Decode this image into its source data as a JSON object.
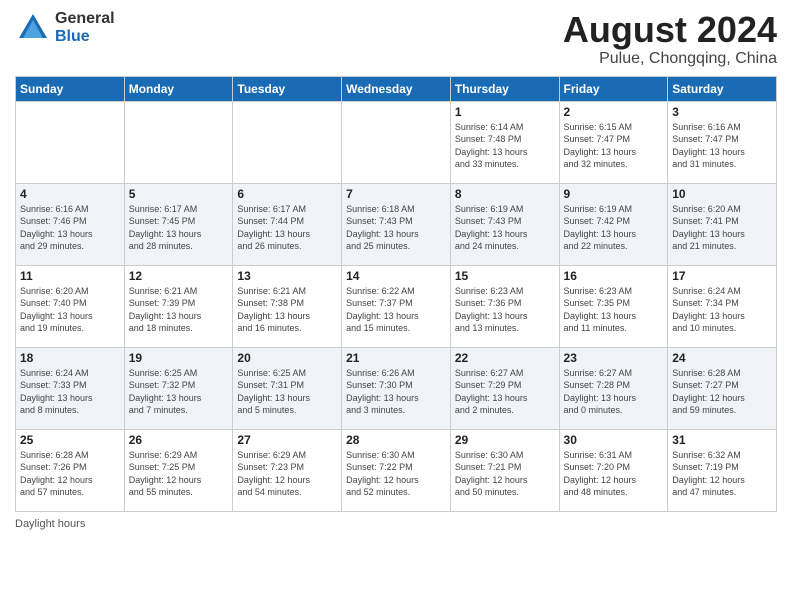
{
  "header": {
    "logo_general": "General",
    "logo_blue": "Blue",
    "month_year": "August 2024",
    "location": "Pulue, Chongqing, China"
  },
  "weekdays": [
    "Sunday",
    "Monday",
    "Tuesday",
    "Wednesday",
    "Thursday",
    "Friday",
    "Saturday"
  ],
  "footer": {
    "daylight_label": "Daylight hours"
  },
  "weeks": [
    [
      {
        "day": "",
        "info": ""
      },
      {
        "day": "",
        "info": ""
      },
      {
        "day": "",
        "info": ""
      },
      {
        "day": "",
        "info": ""
      },
      {
        "day": "1",
        "info": "Sunrise: 6:14 AM\nSunset: 7:48 PM\nDaylight: 13 hours\nand 33 minutes."
      },
      {
        "day": "2",
        "info": "Sunrise: 6:15 AM\nSunset: 7:47 PM\nDaylight: 13 hours\nand 32 minutes."
      },
      {
        "day": "3",
        "info": "Sunrise: 6:16 AM\nSunset: 7:47 PM\nDaylight: 13 hours\nand 31 minutes."
      }
    ],
    [
      {
        "day": "4",
        "info": "Sunrise: 6:16 AM\nSunset: 7:46 PM\nDaylight: 13 hours\nand 29 minutes."
      },
      {
        "day": "5",
        "info": "Sunrise: 6:17 AM\nSunset: 7:45 PM\nDaylight: 13 hours\nand 28 minutes."
      },
      {
        "day": "6",
        "info": "Sunrise: 6:17 AM\nSunset: 7:44 PM\nDaylight: 13 hours\nand 26 minutes."
      },
      {
        "day": "7",
        "info": "Sunrise: 6:18 AM\nSunset: 7:43 PM\nDaylight: 13 hours\nand 25 minutes."
      },
      {
        "day": "8",
        "info": "Sunrise: 6:19 AM\nSunset: 7:43 PM\nDaylight: 13 hours\nand 24 minutes."
      },
      {
        "day": "9",
        "info": "Sunrise: 6:19 AM\nSunset: 7:42 PM\nDaylight: 13 hours\nand 22 minutes."
      },
      {
        "day": "10",
        "info": "Sunrise: 6:20 AM\nSunset: 7:41 PM\nDaylight: 13 hours\nand 21 minutes."
      }
    ],
    [
      {
        "day": "11",
        "info": "Sunrise: 6:20 AM\nSunset: 7:40 PM\nDaylight: 13 hours\nand 19 minutes."
      },
      {
        "day": "12",
        "info": "Sunrise: 6:21 AM\nSunset: 7:39 PM\nDaylight: 13 hours\nand 18 minutes."
      },
      {
        "day": "13",
        "info": "Sunrise: 6:21 AM\nSunset: 7:38 PM\nDaylight: 13 hours\nand 16 minutes."
      },
      {
        "day": "14",
        "info": "Sunrise: 6:22 AM\nSunset: 7:37 PM\nDaylight: 13 hours\nand 15 minutes."
      },
      {
        "day": "15",
        "info": "Sunrise: 6:23 AM\nSunset: 7:36 PM\nDaylight: 13 hours\nand 13 minutes."
      },
      {
        "day": "16",
        "info": "Sunrise: 6:23 AM\nSunset: 7:35 PM\nDaylight: 13 hours\nand 11 minutes."
      },
      {
        "day": "17",
        "info": "Sunrise: 6:24 AM\nSunset: 7:34 PM\nDaylight: 13 hours\nand 10 minutes."
      }
    ],
    [
      {
        "day": "18",
        "info": "Sunrise: 6:24 AM\nSunset: 7:33 PM\nDaylight: 13 hours\nand 8 minutes."
      },
      {
        "day": "19",
        "info": "Sunrise: 6:25 AM\nSunset: 7:32 PM\nDaylight: 13 hours\nand 7 minutes."
      },
      {
        "day": "20",
        "info": "Sunrise: 6:25 AM\nSunset: 7:31 PM\nDaylight: 13 hours\nand 5 minutes."
      },
      {
        "day": "21",
        "info": "Sunrise: 6:26 AM\nSunset: 7:30 PM\nDaylight: 13 hours\nand 3 minutes."
      },
      {
        "day": "22",
        "info": "Sunrise: 6:27 AM\nSunset: 7:29 PM\nDaylight: 13 hours\nand 2 minutes."
      },
      {
        "day": "23",
        "info": "Sunrise: 6:27 AM\nSunset: 7:28 PM\nDaylight: 13 hours\nand 0 minutes."
      },
      {
        "day": "24",
        "info": "Sunrise: 6:28 AM\nSunset: 7:27 PM\nDaylight: 12 hours\nand 59 minutes."
      }
    ],
    [
      {
        "day": "25",
        "info": "Sunrise: 6:28 AM\nSunset: 7:26 PM\nDaylight: 12 hours\nand 57 minutes."
      },
      {
        "day": "26",
        "info": "Sunrise: 6:29 AM\nSunset: 7:25 PM\nDaylight: 12 hours\nand 55 minutes."
      },
      {
        "day": "27",
        "info": "Sunrise: 6:29 AM\nSunset: 7:23 PM\nDaylight: 12 hours\nand 54 minutes."
      },
      {
        "day": "28",
        "info": "Sunrise: 6:30 AM\nSunset: 7:22 PM\nDaylight: 12 hours\nand 52 minutes."
      },
      {
        "day": "29",
        "info": "Sunrise: 6:30 AM\nSunset: 7:21 PM\nDaylight: 12 hours\nand 50 minutes."
      },
      {
        "day": "30",
        "info": "Sunrise: 6:31 AM\nSunset: 7:20 PM\nDaylight: 12 hours\nand 48 minutes."
      },
      {
        "day": "31",
        "info": "Sunrise: 6:32 AM\nSunset: 7:19 PM\nDaylight: 12 hours\nand 47 minutes."
      }
    ]
  ]
}
